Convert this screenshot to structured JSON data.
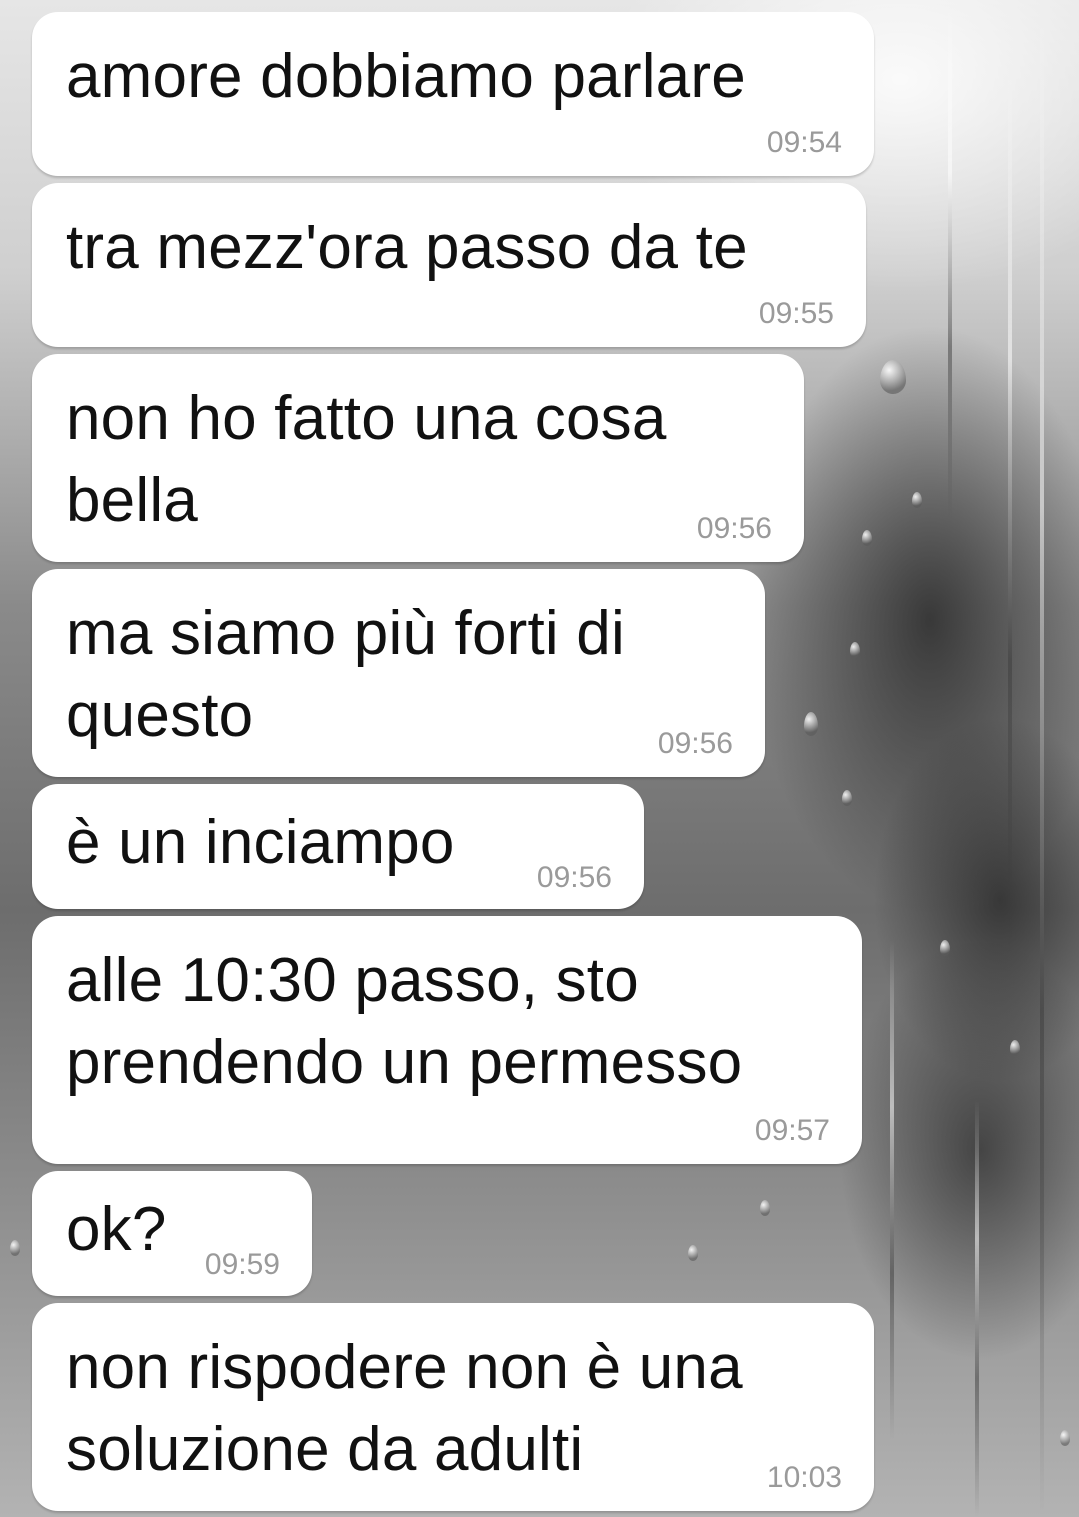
{
  "messages": [
    {
      "text": "amore dobbiamo parlare",
      "time": "09:54"
    },
    {
      "text": "tra mezz'ora passo da te",
      "time": "09:55"
    },
    {
      "text": "non ho fatto una cosa\nbella",
      "time": "09:56"
    },
    {
      "text": "ma siamo più forti di\nquesto",
      "time": "09:56"
    },
    {
      "text": "è un inciampo",
      "time": "09:56"
    },
    {
      "text": "alle 10:30 passo, sto\nprendendo un permesso",
      "time": "09:57"
    },
    {
      "text": "ok?",
      "time": "09:59"
    },
    {
      "text": "non rispodere non è una\nsoluzione da adulti",
      "time": "10:03"
    }
  ]
}
